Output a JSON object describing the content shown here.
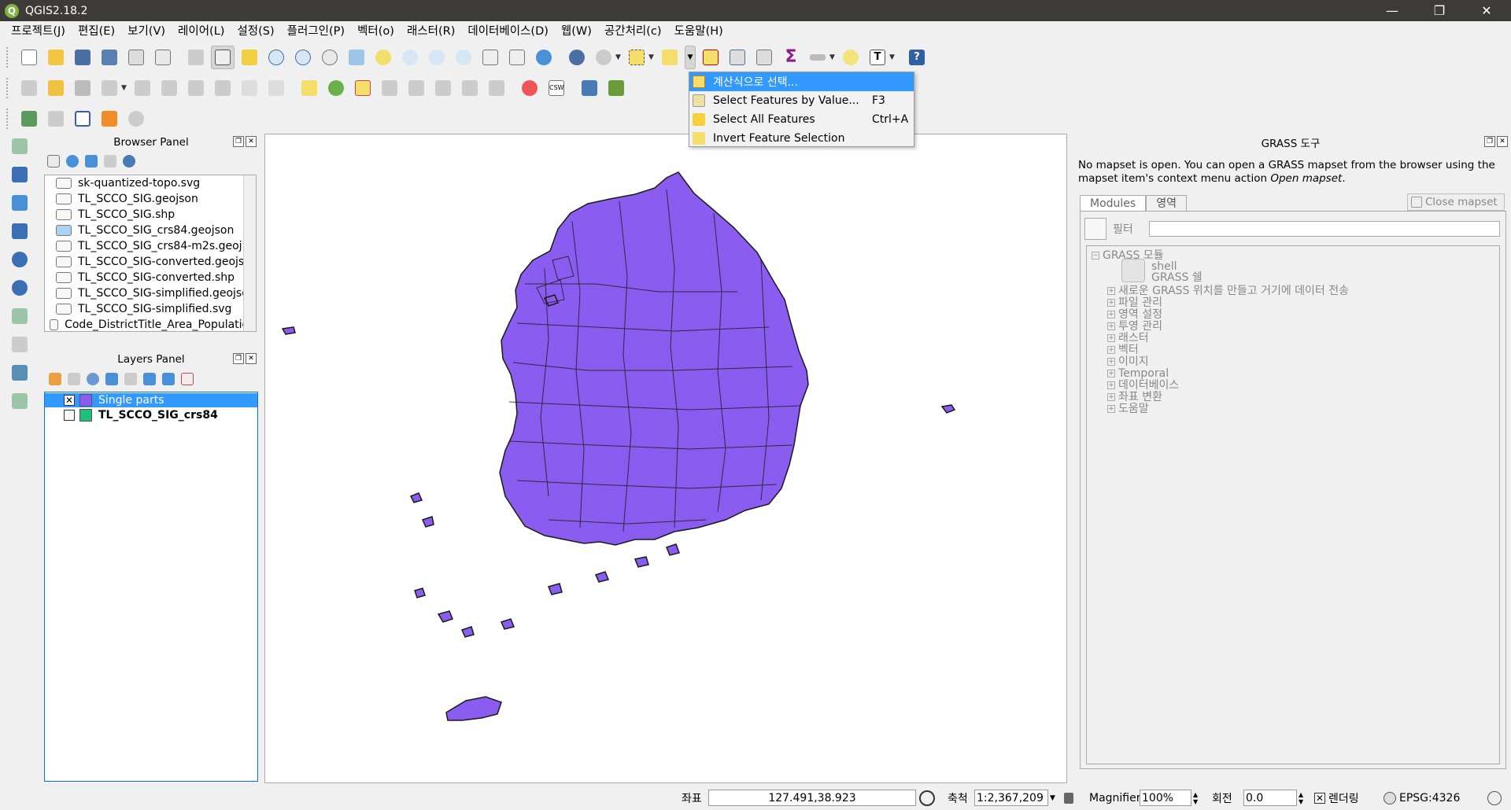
{
  "window": {
    "title": "QGIS2.18.2",
    "app_icon": "qgis-icon",
    "controls": [
      "—",
      "❐",
      "✕"
    ]
  },
  "menubar": [
    "프로젝트(J)",
    "편집(E)",
    "보기(V)",
    "레이어(L)",
    "설정(S)",
    "플러그인(P)",
    "벡터(o)",
    "래스터(R)",
    "데이터베이스(D)",
    "웹(W)",
    "공간처리(c)",
    "도움말(H)"
  ],
  "dropdown": {
    "items": [
      {
        "label": "계산식으로 선택...",
        "shortcut": "",
        "icon": "select-by-expression-icon",
        "selected": true
      },
      {
        "label": "Select Features by Value...",
        "shortcut": "F3",
        "icon": "select-by-value-icon"
      },
      {
        "label": "Select All Features",
        "shortcut": "Ctrl+A",
        "icon": "select-all-icon"
      },
      {
        "label": "Invert Feature Selection",
        "shortcut": "",
        "icon": "invert-selection-icon"
      }
    ]
  },
  "browser_panel": {
    "title": "Browser Panel",
    "items": [
      "sk-quantized-topo.svg",
      "TL_SCCO_SIG.geojson",
      "TL_SCCO_SIG.shp",
      "TL_SCCO_SIG_crs84.geojson",
      "TL_SCCO_SIG_crs84-m2s.geoj",
      "TL_SCCO_SIG-converted.geojs",
      "TL_SCCO_SIG-converted.shp",
      "TL_SCCO_SIG-simplified.geojsc",
      "TL_SCCO_SIG-simplified.svg",
      "Code_DistrictTitle_Area_Population"
    ]
  },
  "layers_panel": {
    "title": "Layers Panel",
    "layers": [
      {
        "name": "Single parts",
        "checked": true,
        "selected": true,
        "color": "#8b5cf0"
      },
      {
        "name": "TL_SCCO_SIG_crs84",
        "checked": false,
        "selected": false,
        "color": "#1fc07a"
      }
    ]
  },
  "grass": {
    "title": "GRASS 도구",
    "message": "No mapset is open. You can open a GRASS mapset from the browser using the mapset item's context menu action",
    "message_action": "Open mapset",
    "tabs": [
      "Modules",
      "영역"
    ],
    "close_mapset": "Close mapset",
    "filter_label": "필터",
    "tree": {
      "root": "GRASS 모듈",
      "children": [
        "shell",
        "GRASS 쉘"
      ],
      "groups": [
        "새로운 GRASS 위치를 만들고 거기에 데이터 전송",
        "파일 관리",
        "영역 설정",
        "투영 관리",
        "래스터",
        "벡터",
        "이미지",
        "Temporal",
        "데이터베이스",
        "좌표 변환",
        "도움말"
      ]
    }
  },
  "status": {
    "coord_label": "좌표",
    "coord_value": "127.491,38.923",
    "scale_label": "축척",
    "scale_value": "1:2,367,209",
    "magnifier_label": "Magnifier",
    "magnifier_value": "100%",
    "rotation_label": "회전",
    "rotation_value": "0.0",
    "render_label": "렌더링",
    "crs": "EPSG:4326"
  },
  "colors": {
    "map_fill": "#8b5cf0",
    "selection": "#3399ff",
    "titlebar": "#3c3b37"
  }
}
